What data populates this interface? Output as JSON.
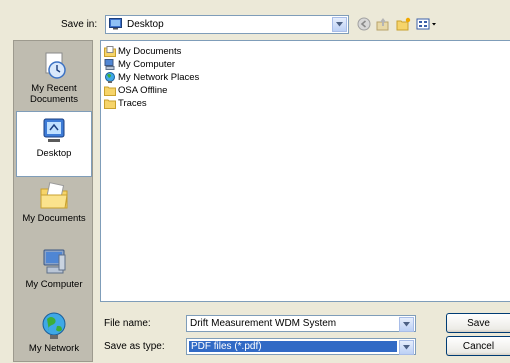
{
  "save_in": {
    "label": "Save in:",
    "location": "Desktop"
  },
  "toolbar": {
    "icons": [
      "back-icon",
      "up-folder-icon",
      "new-folder-icon",
      "view-menu-icon"
    ]
  },
  "places": [
    {
      "label_line1": "My Recent",
      "label_line2": "Documents",
      "icon": "recent-documents-icon"
    },
    {
      "label_line1": "Desktop",
      "label_line2": "",
      "icon": "desktop-icon",
      "selected": true
    },
    {
      "label_line1": "My Documents",
      "label_line2": "",
      "icon": "my-documents-icon"
    },
    {
      "label_line1": "My Computer",
      "label_line2": "",
      "icon": "my-computer-icon"
    },
    {
      "label_line1": "My Network",
      "label_line2": "",
      "icon": "my-network-icon"
    }
  ],
  "files": [
    {
      "name": "My Documents",
      "icon": "documents-folder-icon"
    },
    {
      "name": "My Computer",
      "icon": "computer-icon"
    },
    {
      "name": "My Network Places",
      "icon": "network-places-icon"
    },
    {
      "name": "OSA Offline",
      "icon": "folder-icon"
    },
    {
      "name": "Traces",
      "icon": "folder-icon"
    }
  ],
  "file_name": {
    "label": "File name:",
    "value": "Drift Measurement WDM System"
  },
  "save_as_type": {
    "label": "Save as type:",
    "value": "PDF files (*.pdf)"
  },
  "buttons": {
    "save": "Save",
    "cancel": "Cancel"
  },
  "colors": {
    "selection": "#316ac5",
    "window_bg": "#ece9d8",
    "field_border": "#7f9db9"
  }
}
